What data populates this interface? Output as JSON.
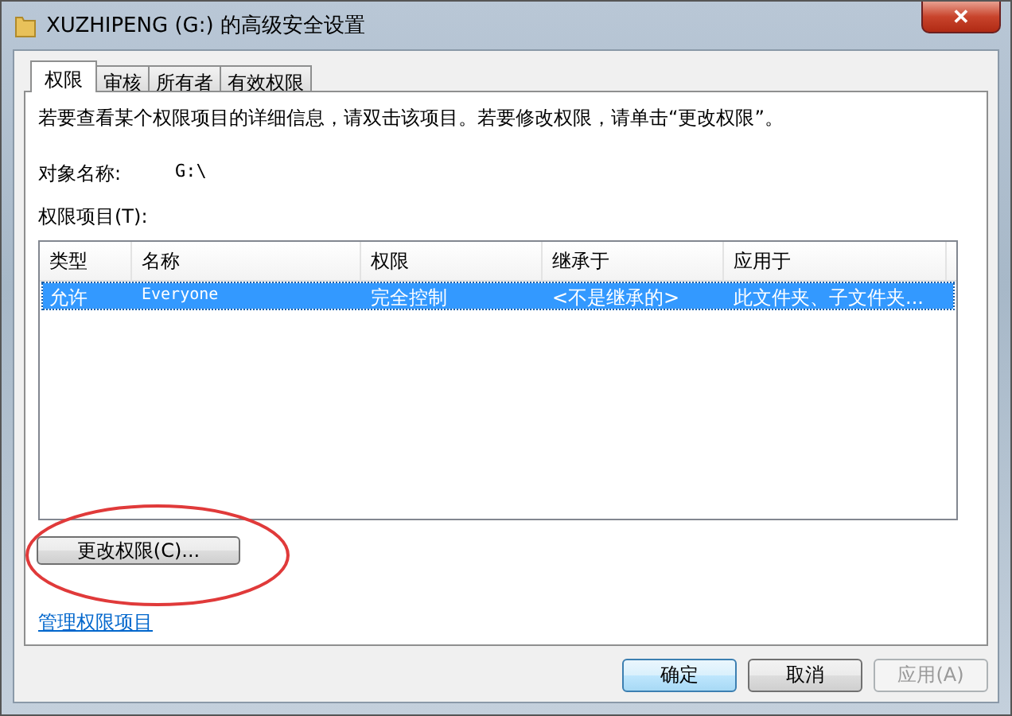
{
  "window": {
    "title": "XUZHIPENG (G:) 的高级安全设置",
    "close": "✕"
  },
  "tabs": [
    {
      "label": "权限",
      "selected": true
    },
    {
      "label": "审核",
      "selected": false
    },
    {
      "label": "所有者",
      "selected": false
    },
    {
      "label": "有效权限",
      "selected": false
    }
  ],
  "instructions": "若要查看某个权限项目的详细信息，请双击该项目。若要修改权限，请单击“更改权限”。",
  "object": {
    "label": "对象名称:",
    "value": "G:\\"
  },
  "list_label": "权限项目(T):",
  "table": {
    "columns": [
      "类型",
      "名称",
      "权限",
      "继承于",
      "应用于"
    ],
    "rows": [
      {
        "cells": [
          "允许",
          "Everyone",
          "完全控制",
          "<不是继承的>",
          "此文件夹、子文件夹..."
        ],
        "selected": true
      }
    ]
  },
  "change_button": {
    "label": "更改权限(C)...",
    "highlighted": true
  },
  "manage_link": "管理权限项目",
  "buttons": [
    {
      "label": "确定",
      "default": true,
      "disabled": false
    },
    {
      "label": "取消",
      "default": false,
      "disabled": false
    },
    {
      "label": "应用(A)",
      "default": false,
      "disabled": true
    }
  ]
}
